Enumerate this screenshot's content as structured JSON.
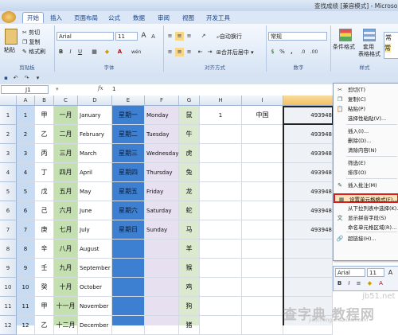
{
  "window": {
    "title": "查找成绩 [兼容模式] - Microso"
  },
  "tabs": [
    "开始",
    "插入",
    "页面布局",
    "公式",
    "数据",
    "审阅",
    "视图",
    "开发工具"
  ],
  "ribbon": {
    "clipboard": {
      "paste": "粘贴",
      "cut": "剪切",
      "copy": "复制",
      "format_painter": "格式刷",
      "label": "剪贴板"
    },
    "font": {
      "name": "Arial",
      "size": "11",
      "label": "字体",
      "bold": "B",
      "italic": "I",
      "underline": "U",
      "grow": "A",
      "shrink": "A",
      "wen": "wén"
    },
    "alignment": {
      "wrap": "自动换行",
      "merge": "合并后居中",
      "label": "对齐方式"
    },
    "number": {
      "format": "常规",
      "label": "数字",
      "percent": "%",
      "comma": ",",
      "dec_inc": ".0",
      "dec_dec": ".00"
    },
    "styles": {
      "cond": "条件格式",
      "table": "套用",
      "table2": "表格格式",
      "cell_style": "样式",
      "right_tag": "常",
      "right_top": "常"
    }
  },
  "formula_bar": {
    "name_box": "J1",
    "fx": "fx",
    "value": "1"
  },
  "columns": [
    "A",
    "B",
    "C",
    "D",
    "E",
    "F",
    "G",
    "H",
    "I",
    "J"
  ],
  "rows": [
    {
      "n": "1",
      "a": "1",
      "b": "甲",
      "c": "一月",
      "d": "January",
      "e": "星期一",
      "f": "Monday",
      "g": "鼠",
      "h": "1",
      "i": "中国",
      "j": "493948"
    },
    {
      "n": "2",
      "a": "2",
      "b": "乙",
      "c": "二月",
      "d": "February",
      "e": "星期二",
      "f": "Tuesday",
      "g": "牛",
      "h": "",
      "i": "",
      "j": "493948"
    },
    {
      "n": "3",
      "a": "3",
      "b": "丙",
      "c": "三月",
      "d": "March",
      "e": "星期三",
      "f": "Wednesday",
      "g": "虎",
      "h": "",
      "i": "",
      "j": "493948"
    },
    {
      "n": "4",
      "a": "4",
      "b": "丁",
      "c": "四月",
      "d": "April",
      "e": "星期四",
      "f": "Thursday",
      "g": "兔",
      "h": "",
      "i": "",
      "j": "493948"
    },
    {
      "n": "5",
      "a": "5",
      "b": "戊",
      "c": "五月",
      "d": "May",
      "e": "星期五",
      "f": "Friday",
      "g": "龙",
      "h": "",
      "i": "",
      "j": "493948"
    },
    {
      "n": "6",
      "a": "6",
      "b": "己",
      "c": "六月",
      "d": "June",
      "e": "星期六",
      "f": "Saturday",
      "g": "蛇",
      "h": "",
      "i": "",
      "j": "493948"
    },
    {
      "n": "7",
      "a": "7",
      "b": "庚",
      "c": "七月",
      "d": "July",
      "e": "星期日",
      "f": "Sunday",
      "g": "马",
      "h": "",
      "i": "",
      "j": "493948"
    },
    {
      "n": "8",
      "a": "8",
      "b": "辛",
      "c": "八月",
      "d": "August",
      "e": "",
      "f": "",
      "g": "羊",
      "h": "",
      "i": "",
      "j": ""
    },
    {
      "n": "9",
      "a": "9",
      "b": "壬",
      "c": "九月",
      "d": "September",
      "e": "",
      "f": "",
      "g": "猴",
      "h": "",
      "i": "",
      "j": ""
    },
    {
      "n": "10",
      "a": "10",
      "b": "癸",
      "c": "十月",
      "d": "October",
      "e": "",
      "f": "",
      "g": "鸡",
      "h": "",
      "i": "",
      "j": ""
    },
    {
      "n": "11",
      "a": "11",
      "b": "甲",
      "c": "十一月",
      "d": "November",
      "e": "",
      "f": "",
      "g": "狗",
      "h": "",
      "i": "",
      "j": ""
    },
    {
      "n": "12",
      "a": "12",
      "b": "乙",
      "c": "十二月",
      "d": "December",
      "e": "",
      "f": "",
      "g": "猪",
      "h": "",
      "i": "",
      "j": ""
    }
  ],
  "context_menu": [
    {
      "icon": "cut-icon",
      "glyph": "✂",
      "label": "剪切(T)"
    },
    {
      "icon": "copy-icon",
      "glyph": "❐",
      "label": "复制(C)"
    },
    {
      "icon": "paste-icon",
      "glyph": "📋",
      "label": "粘贴(P)"
    },
    {
      "icon": "",
      "glyph": "",
      "label": "选择性粘贴(V)..."
    },
    {
      "icon": "",
      "glyph": "",
      "label": "插入(I)..."
    },
    {
      "icon": "",
      "glyph": "",
      "label": "删除(D)..."
    },
    {
      "icon": "",
      "glyph": "",
      "label": "清除内容(N)"
    },
    {
      "icon": "",
      "glyph": "",
      "label": "筛选(E)"
    },
    {
      "icon": "",
      "glyph": "",
      "label": "排序(O)"
    },
    {
      "icon": "comment-icon",
      "glyph": "✎",
      "label": "插入批注(M)"
    },
    {
      "icon": "format-cells-icon",
      "glyph": "▦",
      "label": "设置单元格格式(F)..."
    },
    {
      "icon": "",
      "glyph": "",
      "label": "从下拉列表中选择(K)..."
    },
    {
      "icon": "phonetic-icon",
      "glyph": "文",
      "label": "显示拼音字段(S)"
    },
    {
      "icon": "",
      "glyph": "",
      "label": "命名单元格区域(R)..."
    },
    {
      "icon": "hyperlink-icon",
      "glyph": "🔗",
      "label": "超链接(H)..."
    }
  ],
  "mini_toolbar": {
    "font": "Arial",
    "size": "11"
  },
  "watermark": {
    "site": "jb51.net",
    "brand": "查字典 教程网",
    "url": "jiaocheng.chazidian.com"
  },
  "colors": {
    "col_c": "#c4dfb0",
    "col_e": "#3d7fd1",
    "col_f": "#e6e0f0",
    "col_g": "#dbe9cf",
    "col_a": "#c7dbf2",
    "highlight": "#d42020"
  }
}
